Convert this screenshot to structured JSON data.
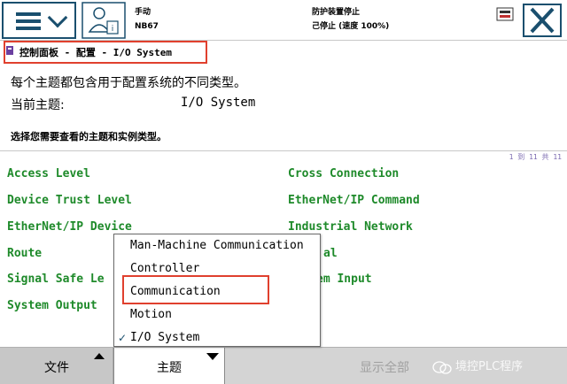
{
  "topbar": {
    "mode": "手动",
    "device": "NB67",
    "protection_status": "防护装置停止",
    "run_status": "己停止 (速度 100%)"
  },
  "breadcrumb": "控制面板 - 配置 - I/O System",
  "header": {
    "description": "每个主题都包含用于配置系统的不同类型。",
    "current_topic_label": "当前主题:",
    "current_topic_value": "I/O System",
    "instruction": "选择您需要查看的主题和实例类型。"
  },
  "pager": "1 到 11 共 11",
  "topics": [
    "Access Level",
    "Device Trust Level",
    "EtherNet/IP Device",
    "Route",
    "Signal Safe Le",
    "System Output",
    "Cross Connection",
    "EtherNet/IP Command",
    "Industrial Network",
    "al",
    "em Input"
  ],
  "popup_menu": {
    "items": [
      "Man-Machine Communication",
      "Controller",
      "Communication",
      "Motion",
      "I/O System"
    ],
    "checked_mark": "✓"
  },
  "bottombar": {
    "file_label": "文件",
    "topic_label": "主题",
    "show_all_label": "显示全部",
    "watermark": "境控PLC程序"
  },
  "colors": {
    "topic_green": "#1e8a2a",
    "highlight_red": "#e0402e",
    "frame_blue": "#1a4f6e"
  }
}
